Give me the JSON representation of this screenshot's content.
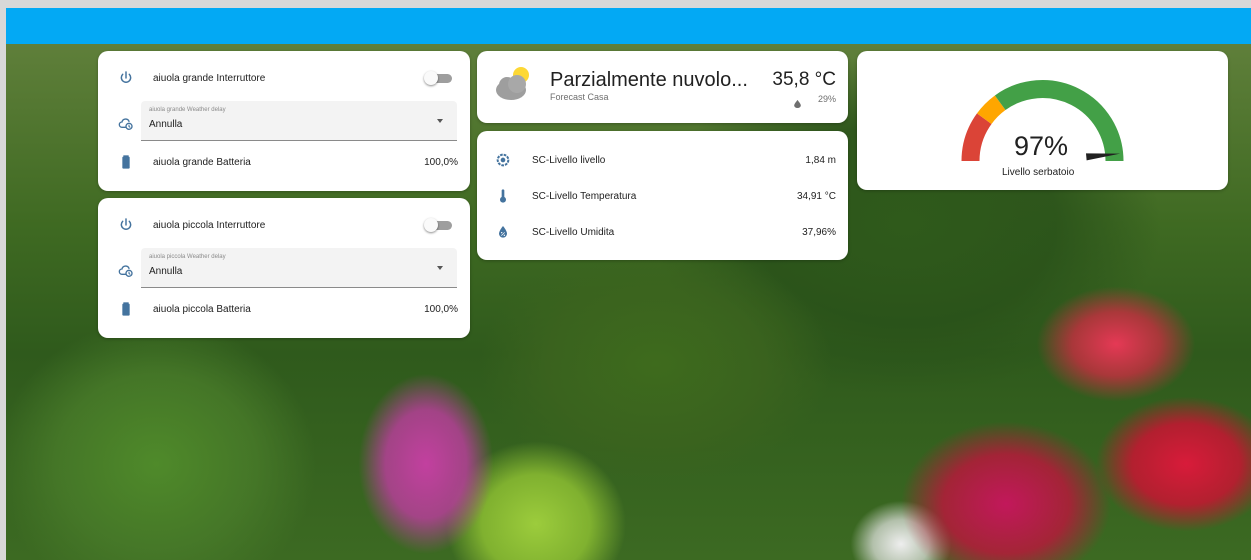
{
  "colors": {
    "header": "#03a9f4",
    "card": "#ffffff",
    "icon": "#44739e",
    "gauge_red": "#db4437",
    "gauge_yellow": "#ffa600",
    "gauge_green": "#43a047"
  },
  "cards": {
    "grande": {
      "switch_label": "aiuola grande Interruttore",
      "switch_icon": "power-icon",
      "switch_on": false,
      "select_label": "aiuola grande Weather delay",
      "select_value": "Annulla",
      "select_icon": "cloud-clock-icon",
      "battery_label": "aiuola grande Batteria",
      "battery_value": "100,0%",
      "battery_icon": "battery-icon"
    },
    "piccola": {
      "switch_label": "aiuola piccola Interruttore",
      "switch_icon": "power-icon",
      "switch_on": false,
      "select_label": "aiuola piccola Weather delay",
      "select_value": "Annulla",
      "select_icon": "cloud-clock-icon",
      "battery_label": "aiuola piccola Batteria",
      "battery_value": "100,0%",
      "battery_icon": "battery-icon"
    }
  },
  "weather": {
    "condition": "Parzialmente nuvolo...",
    "source": "Forecast Casa",
    "temperature": "35,8 °C",
    "humidity": "29%",
    "icon": "partly-cloudy-icon"
  },
  "sensors": [
    {
      "label": "SC-Livello livello",
      "value": "1,84 m",
      "icon": "gauge-icon"
    },
    {
      "label": "SC-Livello Temperatura",
      "value": "34,91 °C",
      "icon": "thermometer-icon"
    },
    {
      "label": "SC-Livello Umidita",
      "value": "37,96%",
      "icon": "water-percent-icon"
    }
  ],
  "gauge": {
    "value_text": "97%",
    "value": 97,
    "min": 0,
    "max": 100,
    "name": "Livello serbatoio"
  }
}
